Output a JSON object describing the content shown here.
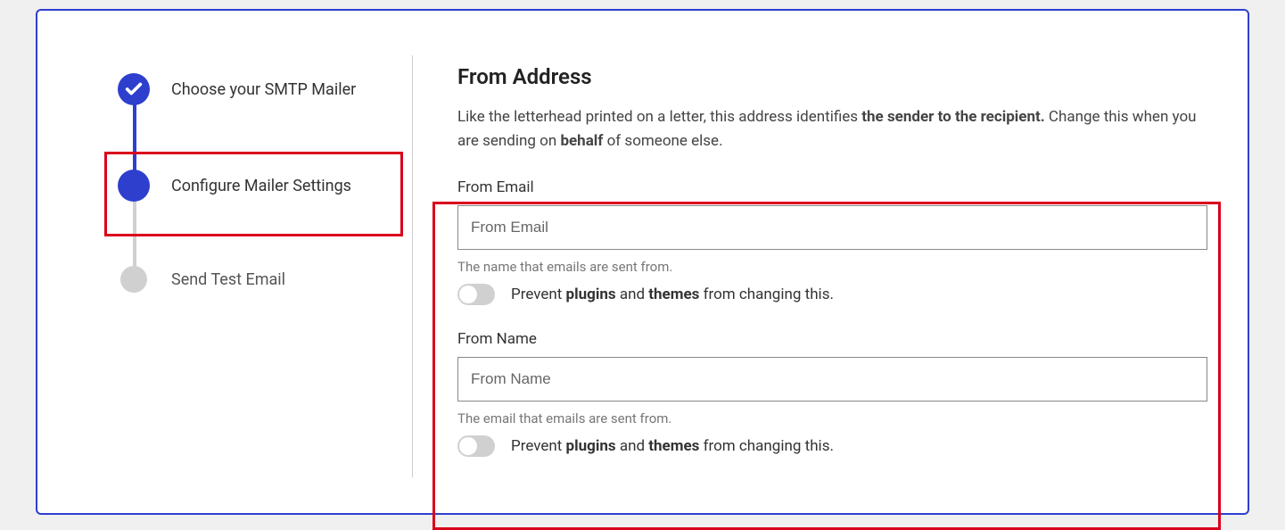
{
  "colors": {
    "primary": "#2e3fce",
    "highlight": "#d9001b"
  },
  "steps": [
    {
      "label": "Choose your SMTP Mailer",
      "status": "complete"
    },
    {
      "label": "Configure Mailer Settings",
      "status": "current"
    },
    {
      "label": "Send Test Email",
      "status": "pending"
    }
  ],
  "content": {
    "title": "From Address",
    "description_parts": [
      "Like the letterhead printed on a letter, this address identifies ",
      "the sender to the recipient.",
      " Change this when you are sending on ",
      "behalf",
      " of someone else."
    ],
    "from_email": {
      "label": "From Email",
      "placeholder": "From Email",
      "value": "",
      "help": "The name that emails are sent from.",
      "toggle_parts": [
        "Prevent ",
        "plugins",
        " and ",
        "themes",
        " from changing this."
      ],
      "toggle_on": false
    },
    "from_name": {
      "label": "From Name",
      "placeholder": "From Name",
      "value": "",
      "help": "The email that emails are sent from.",
      "toggle_parts": [
        "Prevent ",
        "plugins",
        " and ",
        "themes",
        " from changing this."
      ],
      "toggle_on": false
    }
  }
}
